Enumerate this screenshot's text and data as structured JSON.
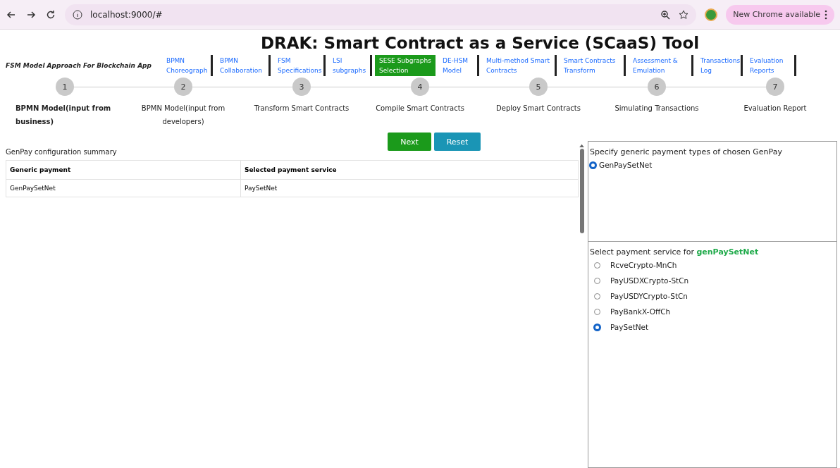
{
  "browser": {
    "url": "localhost:9000/#",
    "update_label": "New Chrome available"
  },
  "title": "DRAK: Smart Contract as a Service (SCaaS) Tool",
  "nav": {
    "brand": "FSM Model Approach For Blockchain App",
    "tabs": [
      {
        "label": "BPMN Choreograph",
        "selected": false
      },
      {
        "label": "BPMN Collaboration",
        "selected": false
      },
      {
        "label": "FSM Specifications",
        "selected": false
      },
      {
        "label": "LSI subgraphs",
        "selected": false
      },
      {
        "label": "SESE Subgraphs Selection",
        "selected": true
      },
      {
        "label": "DE-HSM Model",
        "selected": false
      },
      {
        "label": "Multi-method Smart Contracts",
        "selected": false
      },
      {
        "label": "Smart Contracts Transform",
        "selected": false
      },
      {
        "label": "Assessment & Emulation",
        "selected": false
      },
      {
        "label": "Transactions Log",
        "selected": false
      },
      {
        "label": "Evaluation Reports",
        "selected": false
      }
    ]
  },
  "steps": [
    {
      "number": "1",
      "label": "BPMN Model(input from business)",
      "selected": true
    },
    {
      "number": "2",
      "label": "BPMN Model(input from developers)",
      "selected": false
    },
    {
      "number": "3",
      "label": "Transform Smart Contracts",
      "selected": false
    },
    {
      "number": "4",
      "label": "Compile Smart Contracts",
      "selected": false
    },
    {
      "number": "5",
      "label": "Deploy Smart Contracts",
      "selected": false
    },
    {
      "number": "6",
      "label": "Simulating Transactions",
      "selected": false
    },
    {
      "number": "7",
      "label": "Evaluation Report",
      "selected": false
    }
  ],
  "buttons": {
    "next": "Next",
    "reset": "Reset"
  },
  "summary": {
    "title": "GenPay configuration summary",
    "columns": [
      "Generic payment",
      "Selected payment service"
    ],
    "rows": [
      [
        "GenPaySetNet",
        "PaySetNet"
      ]
    ]
  },
  "generic_types": {
    "title": "Specify generic payment types of chosen GenPay",
    "options": [
      {
        "label": "GenPaySetNet",
        "selected": true
      }
    ]
  },
  "service": {
    "title": "Select payment service for ",
    "highlight": "genPaySetNet",
    "options": [
      {
        "label": "RcveCrypto-MnCh",
        "selected": false
      },
      {
        "label": "PayUSDXCrypto-StCn",
        "selected": false
      },
      {
        "label": "PayUSDYCrypto-StCn",
        "selected": false
      },
      {
        "label": "PayBankX-OffCh",
        "selected": false
      },
      {
        "label": "PaySetNet",
        "selected": true
      }
    ]
  }
}
